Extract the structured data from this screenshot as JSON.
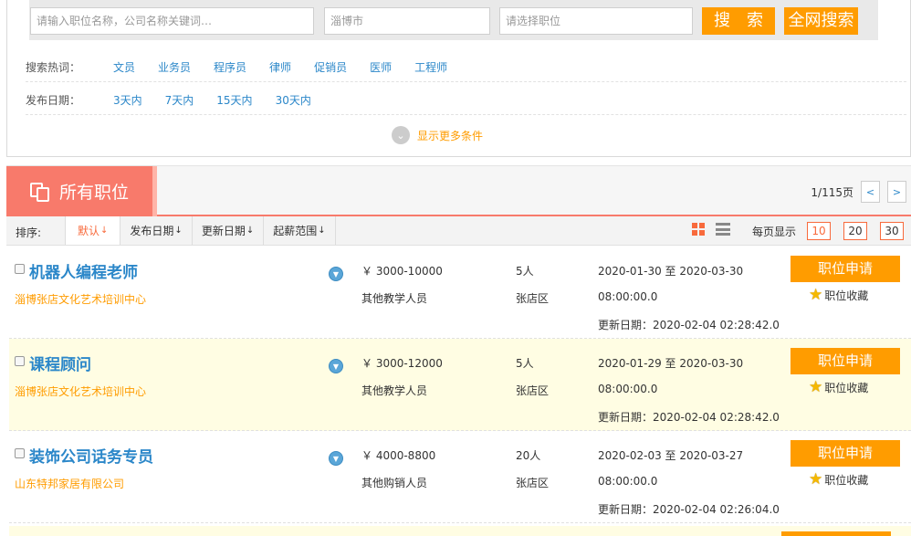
{
  "search": {
    "keyword_placeholder": "请输入职位名称，公司名称关键词…",
    "city_placeholder": "淄博市",
    "position_placeholder": "请选择职位",
    "search_button": "搜　索",
    "global_search_button": "全网搜索"
  },
  "filters": {
    "hot_label": "搜索热词：",
    "hot_terms": [
      "文员",
      "业务员",
      "程序员",
      "律师",
      "促销员",
      "医师",
      "工程师"
    ],
    "date_label": "发布日期：",
    "date_options": [
      "3天内",
      "7天内",
      "15天内",
      "30天内"
    ],
    "more_label": "显示更多条件"
  },
  "list_header": {
    "tab_label": "所有职位",
    "page_indicator": "1/115页",
    "prev": "<",
    "next": ">"
  },
  "sort_bar": {
    "label": "排序:",
    "items": [
      {
        "label": "默认",
        "arrow": "↓"
      },
      {
        "label": "发布日期",
        "arrow": "↓"
      },
      {
        "label": "更新日期",
        "arrow": "↓"
      },
      {
        "label": "起薪范围",
        "arrow": "↓"
      }
    ],
    "per_page_label": "每页显示",
    "per_page_options": [
      "10",
      "20",
      "30"
    ]
  },
  "jobs": [
    {
      "title": "机器人编程老师",
      "company": "淄博张店文化艺术培训中心",
      "salary": "￥ 3000-10000",
      "category": "其他教学人员",
      "headcount": "5人",
      "district": "张店区",
      "date_range": "2020-01-30 至 2020-03-30",
      "time": "08:00:00.0",
      "updated": "更新日期：2020-02-04 02:28:42.0",
      "apply": "职位申请",
      "favorite": "职位收藏"
    },
    {
      "title": "课程顾问",
      "company": "淄博张店文化艺术培训中心",
      "salary": "￥ 3000-12000",
      "category": "其他教学人员",
      "headcount": "5人",
      "district": "张店区",
      "date_range": "2020-01-29 至 2020-03-30",
      "time": "08:00:00.0",
      "updated": "更新日期：2020-02-04 02:28:42.0",
      "apply": "职位申请",
      "favorite": "职位收藏"
    },
    {
      "title": "装饰公司话务专员",
      "company": "山东特邦家居有限公司",
      "salary": "￥ 4000-8800",
      "category": "其他购销人员",
      "headcount": "20人",
      "district": "张店区",
      "date_range": "2020-02-03 至 2020-03-27",
      "time": "08:00:00.0",
      "updated": "更新日期：2020-02-04 02:26:04.0",
      "apply": "职位申请",
      "favorite": "职位收藏"
    }
  ],
  "colors": {
    "accent_orange": "#ff9c00",
    "tab_red": "#f87a6b",
    "link_blue": "#2b87c9",
    "highlight_row": "#fffde3"
  }
}
